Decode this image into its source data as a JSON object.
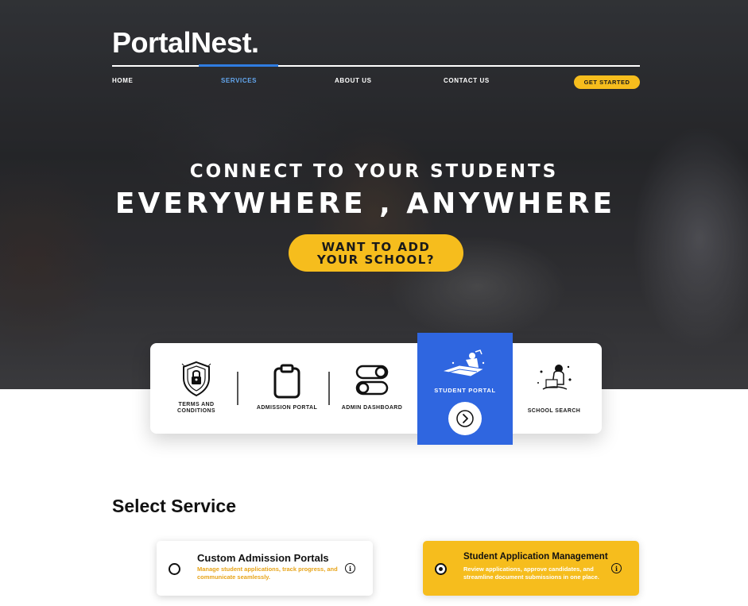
{
  "brand": {
    "logo_text": "PortalNest."
  },
  "nav": {
    "items": [
      {
        "label": "HOME"
      },
      {
        "label": "SERVICES"
      },
      {
        "label": "ABOUT US"
      },
      {
        "label": "CONTACT US"
      }
    ],
    "active": "SERVICES",
    "cta_label": "GET STARTED"
  },
  "hero": {
    "line1": "CONNECT TO YOUR STUDENTS",
    "line2": "EVERYWHERE , ANYWHERE",
    "cta_line1": "WANT TO ADD",
    "cta_line2": "YOUR SCHOOL?"
  },
  "services_strip": {
    "items": [
      {
        "label_line1": "TERMS AND",
        "label_line2": "CONDITIONS",
        "icon": "shield-lock-icon"
      },
      {
        "label": "ADMISSION PORTAL",
        "icon": "clipboard-icon"
      },
      {
        "label": "ADMIN DASHBOARD",
        "icon": "toggle-switches-icon"
      },
      {
        "label": "STUDENT PORTAL",
        "icon": "student-reading-illustration",
        "highlighted": true
      },
      {
        "label": "SCHOOL SEARCH",
        "icon": "student-studying-illustration"
      }
    ]
  },
  "select_service": {
    "title": "Select Service",
    "options": [
      {
        "title": "Custom Admission Portals",
        "description": "Manage student applications, track progress, and communicate seamlessly.",
        "selected": false
      },
      {
        "title": "Student Application Management",
        "description": "Review applications, approve candidates, and streamline document submissions in one place.",
        "selected": true
      }
    ]
  },
  "colors": {
    "accent_yellow": "#f6bd1d",
    "accent_blue": "#2f66e0",
    "nav_active": "#64a8f0"
  }
}
